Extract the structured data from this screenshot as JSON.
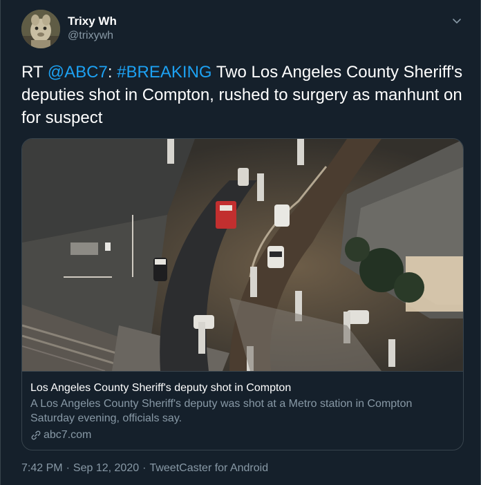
{
  "author": {
    "display_name": "Trixy Wh",
    "handle": "@trixywh"
  },
  "tweet": {
    "prefix": "RT ",
    "mention": "@ABC7",
    "colon": ": ",
    "hashtag": "#BREAKING",
    "body": " Two Los Angeles County Sheriff's deputies shot in Compton, rushed to surgery as manhunt on for suspect"
  },
  "card": {
    "title": "Los Angeles County Sheriff's deputy shot in Compton",
    "description": "A Los Angeles County Sheriff's deputy was shot at a Metro station in Compton Saturday evening, officials say.",
    "domain": "abc7.com"
  },
  "meta": {
    "time": "7:42 PM",
    "separator": "·",
    "date": "Sep 12, 2020",
    "source": "TweetCaster for Android"
  },
  "icons": {
    "caret": "chevron-down-icon",
    "link": "link-icon"
  },
  "colors": {
    "background": "#15202b",
    "accent": "#1da1f2",
    "secondary_text": "#8899a6",
    "border": "#38444d"
  }
}
